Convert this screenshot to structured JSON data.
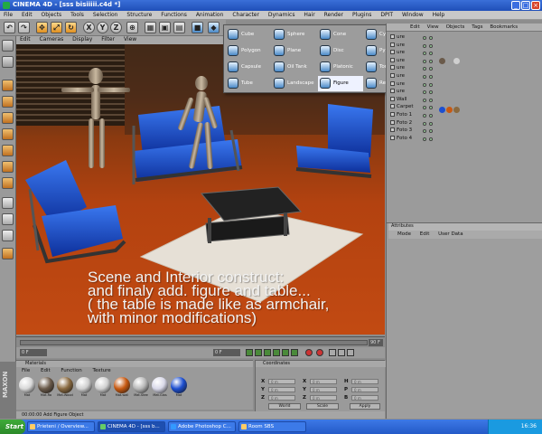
{
  "window": {
    "title": "CINEMA 4D - [sss bisiiiii.c4d *]",
    "controls": [
      "_",
      "□",
      "×"
    ]
  },
  "menubar": [
    "File",
    "Edit",
    "Objects",
    "Tools",
    "Selection",
    "Structure",
    "Functions",
    "Animation",
    "Character",
    "Dynamics",
    "Hair",
    "Render",
    "Plugins",
    "DPIT",
    "Window",
    "Help"
  ],
  "toolbar": {
    "x_label": "X",
    "y_label": "Y",
    "z_label": "Z"
  },
  "viewport_menu": [
    "Edit",
    "Cameras",
    "Display",
    "Filter",
    "View"
  ],
  "palette": {
    "items": [
      {
        "label": "Cube"
      },
      {
        "label": "Sphere"
      },
      {
        "label": "Cone"
      },
      {
        "label": "Cylinder"
      },
      {
        "label": "Polygon"
      },
      {
        "label": "Plane"
      },
      {
        "label": "Disc"
      },
      {
        "label": "Pyramid"
      },
      {
        "label": "Capsule"
      },
      {
        "label": "Oil Tank"
      },
      {
        "label": "Platonic"
      },
      {
        "label": "Torus"
      },
      {
        "label": "Tube"
      },
      {
        "label": "Landscape"
      },
      {
        "label": "Figure"
      },
      {
        "label": "Relief"
      }
    ],
    "selected": "Figure"
  },
  "object_manager": {
    "menu": [
      "Edit",
      "View",
      "Objects",
      "Tags",
      "Bookmarks"
    ],
    "rows": [
      {
        "label": "ure"
      },
      {
        "label": "ure"
      },
      {
        "label": "ure"
      },
      {
        "label": "ure"
      },
      {
        "label": "ure"
      },
      {
        "label": "ure"
      },
      {
        "label": "ure"
      },
      {
        "label": "ure"
      },
      {
        "label": "Wall"
      },
      {
        "label": "Carpet"
      },
      {
        "label": "Foto 1"
      },
      {
        "label": "Foto 2"
      },
      {
        "label": "Foto 3"
      },
      {
        "label": "Foto 4"
      }
    ]
  },
  "attributes": {
    "title": "Attributes",
    "menu": [
      "Mode",
      "Edit",
      "User Data"
    ]
  },
  "caption": {
    "line1": "Scene and Interior construct:",
    "line2": "and finaly add. figure and table...",
    "line3": "( the table is made like as armchair,",
    "line4": "with minor modifications)"
  },
  "animation": {
    "frame_start": "0 F",
    "frame_current": "0 F",
    "frame_end": "90 F"
  },
  "materials": {
    "title": "Materials",
    "menu": [
      "File",
      "Edit",
      "Function",
      "Texture"
    ],
    "swatches": [
      {
        "label": "Mat",
        "color": "#d8d8d8"
      },
      {
        "label": "Mat.Ra",
        "color": "#6a5a4a"
      },
      {
        "label": "Mat.Wood",
        "color": "#8a6a40"
      },
      {
        "label": "Mat",
        "color": "#cfcfcf"
      },
      {
        "label": "Mat",
        "color": "#d0d0d0"
      },
      {
        "label": "Mat.wall",
        "color": "#c85a12"
      },
      {
        "label": "Mat.Stee",
        "color": "#b8b8b8"
      },
      {
        "label": "Mat.Glas",
        "color": "#d8d8e8"
      },
      {
        "label": "Mat",
        "color": "#1d4fd0"
      }
    ]
  },
  "coordinates": {
    "title": "Coordinates",
    "position_axes": [
      "X",
      "Y",
      "Z"
    ],
    "rotation_axes": [
      "H",
      "P",
      "B"
    ],
    "field_placeholder": "0 m",
    "world_label": "World",
    "scale_label": "Scale",
    "apply_label": "Apply"
  },
  "status": {
    "text": "00:00:00  Add Figure Object"
  },
  "side_brand": "MAXON",
  "taskbar": {
    "start": "Start",
    "tasks": [
      "Prieteni / Overview...",
      "CINEMA 4D - [sss b...",
      "Adobe Photoshop C...",
      "Room SBS"
    ],
    "clock": "16:36"
  },
  "colors": {
    "sofa_blue": "#1d4fd0",
    "floor": "#b94410",
    "selection": "#eef2ff"
  }
}
